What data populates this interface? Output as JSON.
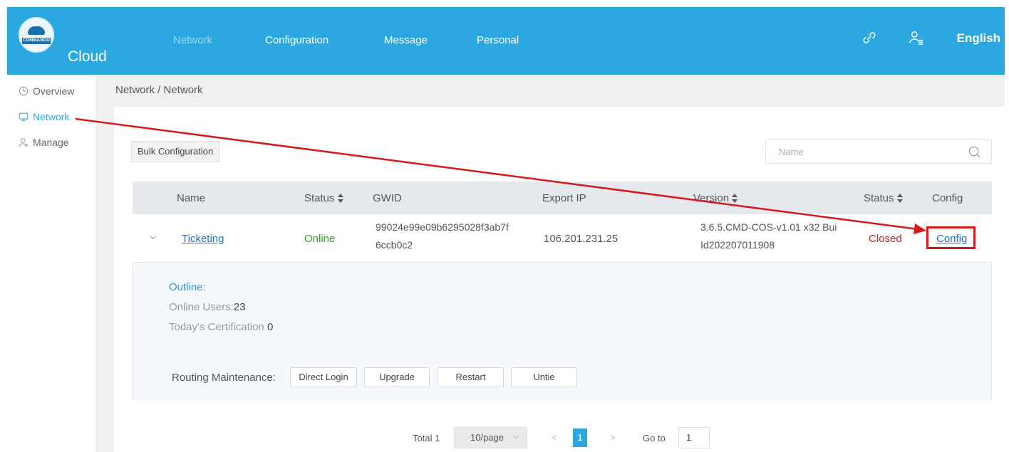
{
  "header": {
    "logo_text": "COMMANDO",
    "brand": "Cloud",
    "nav": [
      {
        "label": "Network",
        "active": true
      },
      {
        "label": "Configuration"
      },
      {
        "label": "Message"
      },
      {
        "label": "Personal"
      }
    ],
    "icons": [
      "link-icon",
      "user-list-icon"
    ],
    "language": "English"
  },
  "sidebar": {
    "items": [
      {
        "label": "Overview",
        "icon": "clock-icon"
      },
      {
        "label": "Network",
        "icon": "monitor-icon",
        "active": true
      },
      {
        "label": "Manage",
        "icon": "user-icon"
      }
    ]
  },
  "breadcrumb": "Network / Network",
  "toolbar": {
    "bulk_label": "Bulk Configuration",
    "search_placeholder": "Name"
  },
  "table": {
    "columns": [
      "Name",
      "Status",
      "GWID",
      "Export IP",
      "Version",
      "Status",
      "Config"
    ],
    "rows": [
      {
        "name": "Ticketing",
        "status": "Online",
        "gwid_line1": "99024e99e09b6295028f3ab7f",
        "gwid_line2": "6ccb0c2",
        "export_ip": "106.201.231.25",
        "version_line1": "3.6.5.CMD-COS-v1.01 x32 Bui",
        "version_line2": "Id202207011908",
        "status2": "Closed",
        "config": "Config"
      }
    ]
  },
  "detail": {
    "outline": "Outline:",
    "online_users_label": "Online Users:",
    "online_users_value": "23",
    "certification_label": "Today's Certification ",
    "certification_value": "0",
    "routing_label": "Routing Maintenance:",
    "buttons": [
      "Direct Login",
      "Upgrade",
      "Restart",
      "Untie"
    ]
  },
  "pagination": {
    "total": "Total 1",
    "page_size": "10/page",
    "prev": "<",
    "current": "1",
    "next": ">",
    "goto_label": "Go to",
    "goto_value": "1"
  },
  "colors": {
    "header": "#2ba8df",
    "annotation": "#d31a1a",
    "link": "#1e6fc8",
    "online": "#3c9a2e",
    "closed": "#c3282b"
  }
}
